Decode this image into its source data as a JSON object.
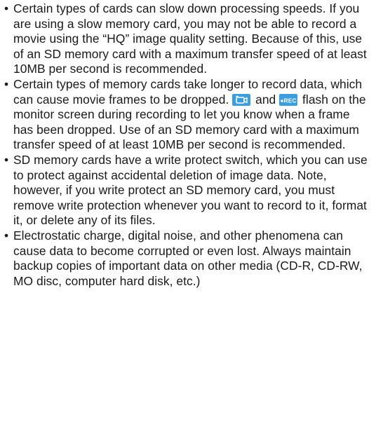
{
  "bullets": [
    {
      "text": "Certain types of cards can slow down processing speeds. If you are using a slow memory card, you may not be able to record a movie using the “HQ” image quality setting. Because of this, use of an SD memory card with a maximum transfer speed of at least 10MB per second is recommended."
    },
    {
      "text_after_icons": " flash on the monitor screen during recording to let you know when a frame has been dropped. Use of an SD memory card with a maximum transfer speed of at least 10MB per second is recommended.",
      "text_before_icons": "Certain types of memory cards take longer to record data, which can cause movie frames to be dropped. ",
      "icon_joiner": " and ",
      "icons": [
        "movie-camera-icon",
        "rec-icon"
      ],
      "rec_icon_label": "●REC"
    },
    {
      "text": "SD memory cards have a write protect switch, which you can use to protect against accidental deletion of image data. Note, however, if you write protect an SD memory card, you must remove write protection whenever you want to record to it, format it, or delete any of its files."
    },
    {
      "text": "Electrostatic charge, digital noise, and other phenomena can cause data to become corrupted or even lost. Always maintain backup copies of important data on other media (CD-R, CD-RW, MO disc, computer hard disk, etc.)"
    }
  ],
  "bullet_glyph": "•",
  "colors": {
    "text": "#1a1a1a",
    "icon_background": "#3a9fe0",
    "icon_foreground": "#ffffff"
  }
}
